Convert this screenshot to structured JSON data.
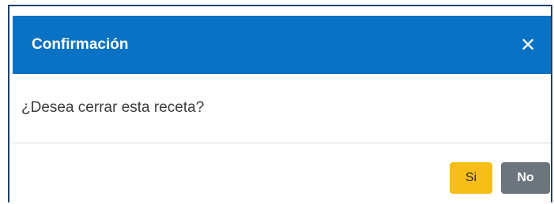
{
  "dialog": {
    "title": "Confirmación",
    "close_icon": "close-icon",
    "message": "¿Desea cerrar esta receta?",
    "buttons": {
      "yes_label": "Si",
      "no_label": "No"
    }
  },
  "colors": {
    "header_background": "#0a72c4",
    "header_text": "#ffffff",
    "yes_button": "#f7be16",
    "no_button": "#6c757d",
    "dialog_border": "#1f3f6b"
  }
}
